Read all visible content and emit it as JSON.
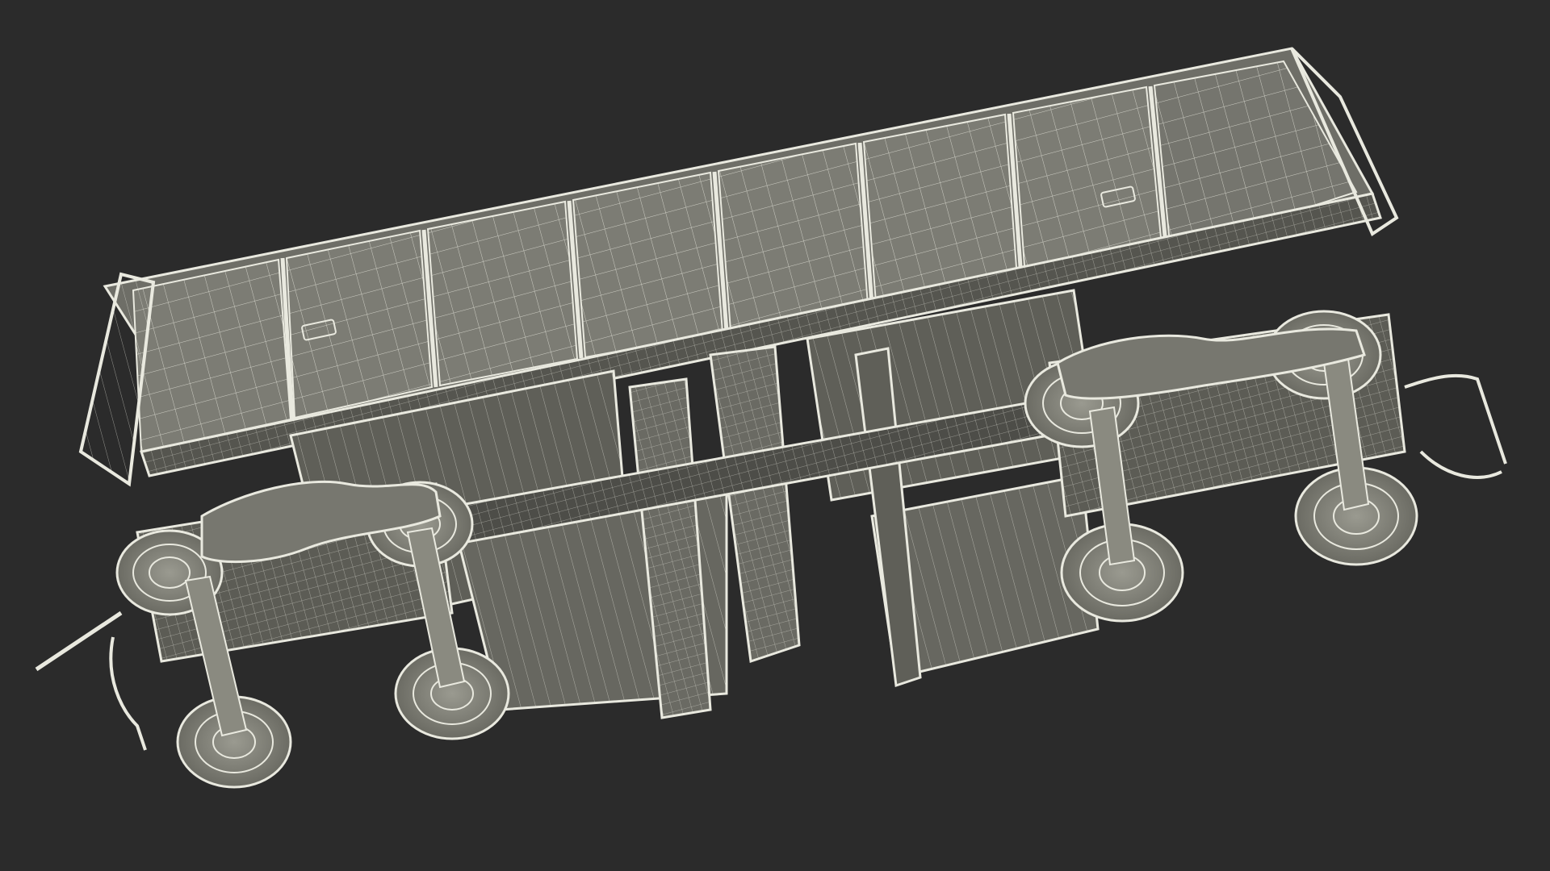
{
  "scene": {
    "subject": "wireframe-render",
    "colors": {
      "background": "#2b2b2b",
      "panel_fill": "#7c7c74",
      "panel_fill_dark": "#55554f",
      "panel_shadow": "#3f3f3a",
      "wire": "#e9e9df",
      "wire_faint": "#c9c9bd",
      "wheel_fill": "#8a8a80"
    }
  }
}
